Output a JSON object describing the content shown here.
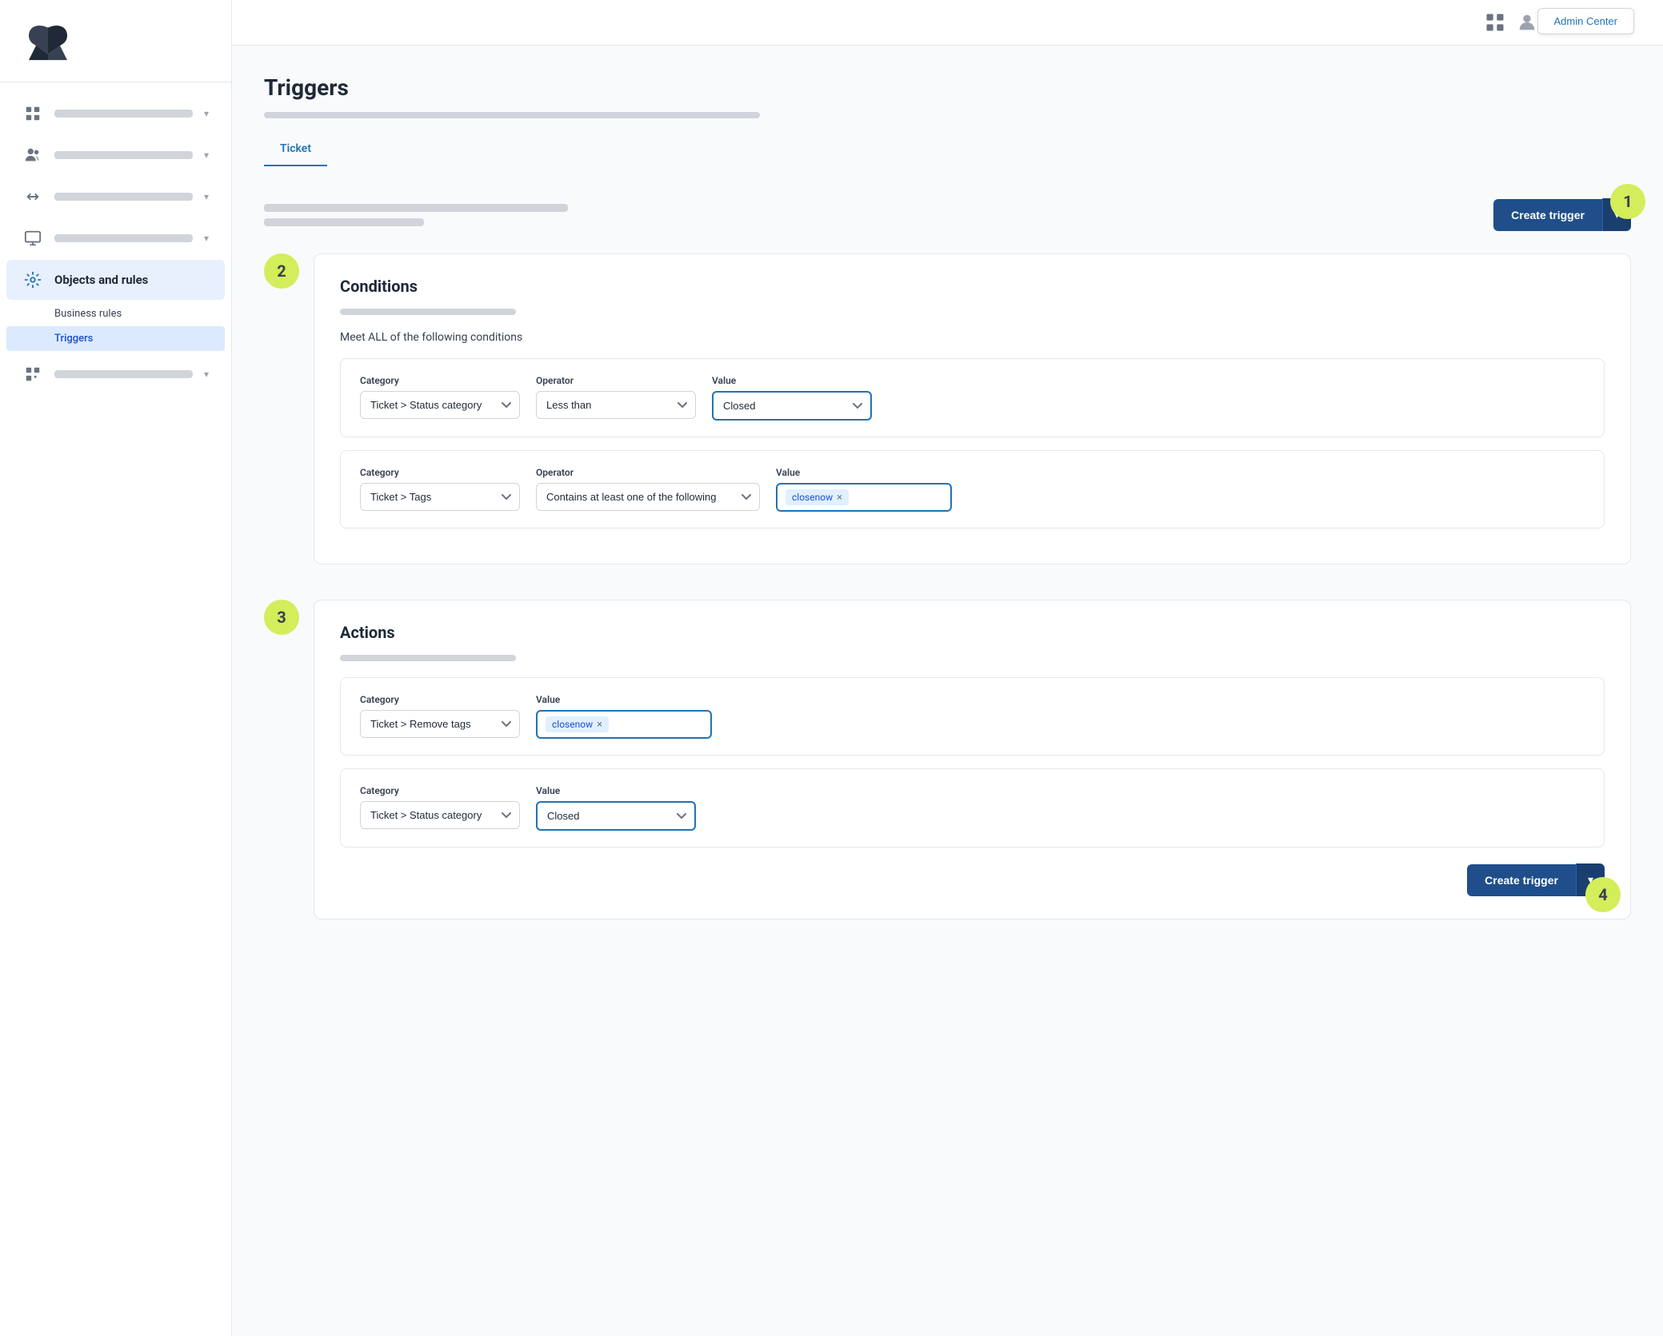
{
  "sidebar": {
    "logo_alt": "Zendesk",
    "nav_items": [
      {
        "id": "buildings",
        "icon": "building",
        "active": false
      },
      {
        "id": "people",
        "icon": "people",
        "active": false
      },
      {
        "id": "arrows",
        "icon": "arrows",
        "active": false
      },
      {
        "id": "monitor",
        "icon": "monitor",
        "active": false
      },
      {
        "id": "objects_rules",
        "icon": "objects",
        "active": true,
        "label": "Objects and rules"
      },
      {
        "id": "grid_plus",
        "icon": "grid_plus",
        "active": false
      }
    ],
    "sub_items": [
      {
        "id": "business_rules",
        "label": "Business rules",
        "active": false
      },
      {
        "id": "triggers",
        "label": "Triggers",
        "active": true
      }
    ]
  },
  "topbar": {
    "admin_center_label": "Admin Center"
  },
  "page": {
    "title": "Triggers",
    "tabs": [
      {
        "id": "ticket",
        "label": "Ticket",
        "active": true
      }
    ]
  },
  "step_badges": {
    "badge1": "1",
    "badge2": "2",
    "badge3": "3",
    "badge4": "4"
  },
  "create_trigger_button": "Create trigger",
  "conditions": {
    "title": "Conditions",
    "meet_all_label": "Meet ALL of the following conditions",
    "rows": [
      {
        "category_label": "Category",
        "category_value": "Ticket > Status category",
        "operator_label": "Operator",
        "operator_value": "Less than",
        "value_label": "Value",
        "value_value": "Closed"
      },
      {
        "category_label": "Category",
        "category_value": "Ticket > Tags",
        "operator_label": "Operator",
        "operator_value": "Contains at least one of the following",
        "value_label": "Value",
        "tag_value": "closenow"
      }
    ]
  },
  "actions": {
    "title": "Actions",
    "rows": [
      {
        "category_label": "Category",
        "category_value": "Ticket > Remove tags",
        "value_label": "Value",
        "tag_value": "closenow"
      },
      {
        "category_label": "Category",
        "category_value": "Ticket > Status category",
        "value_label": "Value",
        "value_value": "Closed"
      }
    ]
  }
}
